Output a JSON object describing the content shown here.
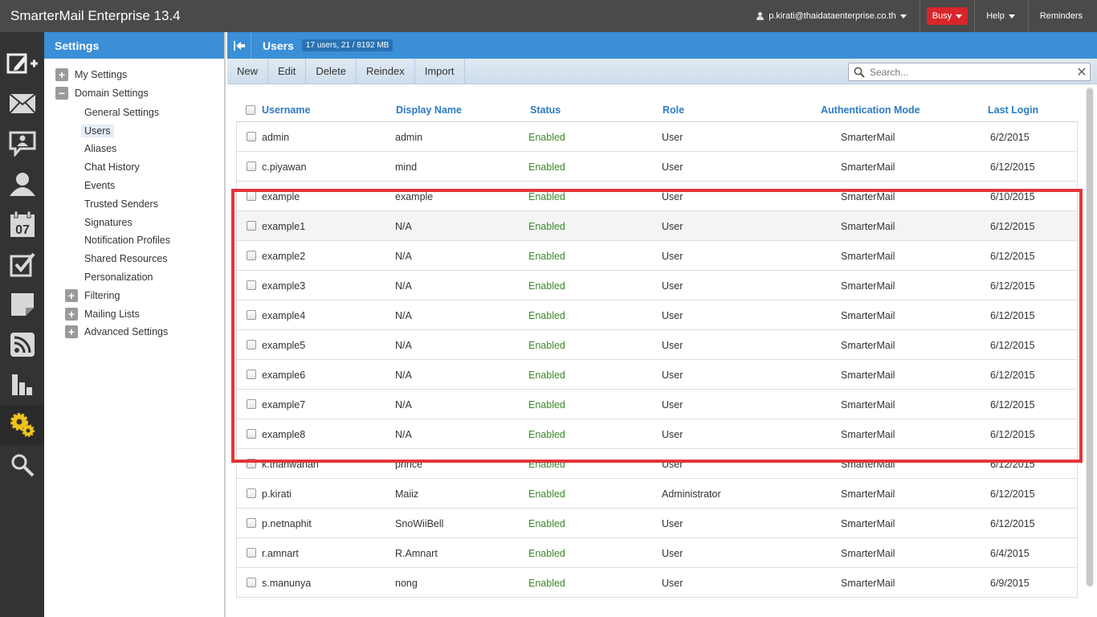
{
  "app": {
    "title": "SmarterMail Enterprise 13.4"
  },
  "topbar": {
    "user": "p.kirati@thaidataenterprise.co.th",
    "status": "Busy",
    "help": "Help",
    "reminders": "Reminders",
    "status_color": "#d9262b"
  },
  "iconbar": {
    "items": [
      "compose-icon",
      "mail-icon",
      "chat-icon",
      "contacts-icon",
      "calendar-icon",
      "tasks-icon",
      "notes-icon",
      "rss-icon",
      "reports-icon",
      "settings-icon",
      "search-icon"
    ],
    "calendar_day": "07"
  },
  "settings": {
    "title": "Settings",
    "tree": {
      "my_settings": "My Settings",
      "domain_settings": "Domain Settings",
      "general_settings": "General Settings",
      "users": "Users",
      "aliases": "Aliases",
      "chat_history": "Chat History",
      "events": "Events",
      "trusted_senders": "Trusted Senders",
      "signatures": "Signatures",
      "notification_profiles": "Notification Profiles",
      "shared_resources": "Shared Resources",
      "personalization": "Personalization",
      "filtering": "Filtering",
      "mailing_lists": "Mailing Lists",
      "advanced_settings": "Advanced Settings"
    }
  },
  "main": {
    "title": "Users",
    "badge": "17 users, 21 / 8192 MB",
    "toolbar": {
      "new": "New",
      "edit": "Edit",
      "delete": "Delete",
      "reindex": "Reindex",
      "import": "Import"
    },
    "search_placeholder": "Search...",
    "columns": {
      "username": "Username",
      "display_name": "Display Name",
      "status": "Status",
      "role": "Role",
      "auth_mode": "Authentication Mode",
      "last_login": "Last Login"
    },
    "rows": [
      {
        "username": "admin",
        "display_name": "admin",
        "status": "Enabled",
        "role": "User",
        "auth": "SmarterMail",
        "last_login": "6/2/2015"
      },
      {
        "username": "c.piyawan",
        "display_name": "mind",
        "status": "Enabled",
        "role": "User",
        "auth": "SmarterMail",
        "last_login": "6/12/2015"
      },
      {
        "username": "example",
        "display_name": "example",
        "status": "Enabled",
        "role": "User",
        "auth": "SmarterMail",
        "last_login": "6/10/2015"
      },
      {
        "username": "example1",
        "display_name": "N/A",
        "status": "Enabled",
        "role": "User",
        "auth": "SmarterMail",
        "last_login": "6/12/2015"
      },
      {
        "username": "example2",
        "display_name": "N/A",
        "status": "Enabled",
        "role": "User",
        "auth": "SmarterMail",
        "last_login": "6/12/2015"
      },
      {
        "username": "example3",
        "display_name": "N/A",
        "status": "Enabled",
        "role": "User",
        "auth": "SmarterMail",
        "last_login": "6/12/2015"
      },
      {
        "username": "example4",
        "display_name": "N/A",
        "status": "Enabled",
        "role": "User",
        "auth": "SmarterMail",
        "last_login": "6/12/2015"
      },
      {
        "username": "example5",
        "display_name": "N/A",
        "status": "Enabled",
        "role": "User",
        "auth": "SmarterMail",
        "last_login": "6/12/2015"
      },
      {
        "username": "example6",
        "display_name": "N/A",
        "status": "Enabled",
        "role": "User",
        "auth": "SmarterMail",
        "last_login": "6/12/2015"
      },
      {
        "username": "example7",
        "display_name": "N/A",
        "status": "Enabled",
        "role": "User",
        "auth": "SmarterMail",
        "last_login": "6/12/2015"
      },
      {
        "username": "example8",
        "display_name": "N/A",
        "status": "Enabled",
        "role": "User",
        "auth": "SmarterMail",
        "last_login": "6/12/2015"
      },
      {
        "username": "k.thanwanan",
        "display_name": "prince",
        "status": "Enabled",
        "role": "User",
        "auth": "SmarterMail",
        "last_login": "6/12/2015"
      },
      {
        "username": "p.kirati",
        "display_name": "Maiiz",
        "status": "Enabled",
        "role": "Administrator",
        "auth": "SmarterMail",
        "last_login": "6/12/2015"
      },
      {
        "username": "p.netnaphit",
        "display_name": "SnoWiiBell",
        "status": "Enabled",
        "role": "User",
        "auth": "SmarterMail",
        "last_login": "6/12/2015"
      },
      {
        "username": "r.amnart",
        "display_name": "R.Amnart",
        "status": "Enabled",
        "role": "User",
        "auth": "SmarterMail",
        "last_login": "6/4/2015"
      },
      {
        "username": "s.manunya",
        "display_name": "nong",
        "status": "Enabled",
        "role": "User",
        "auth": "SmarterMail",
        "last_login": "6/9/2015"
      }
    ],
    "highlight_color": "#e3363a",
    "status_color": "#3a8a2a",
    "accent": "#3b8fd6"
  }
}
